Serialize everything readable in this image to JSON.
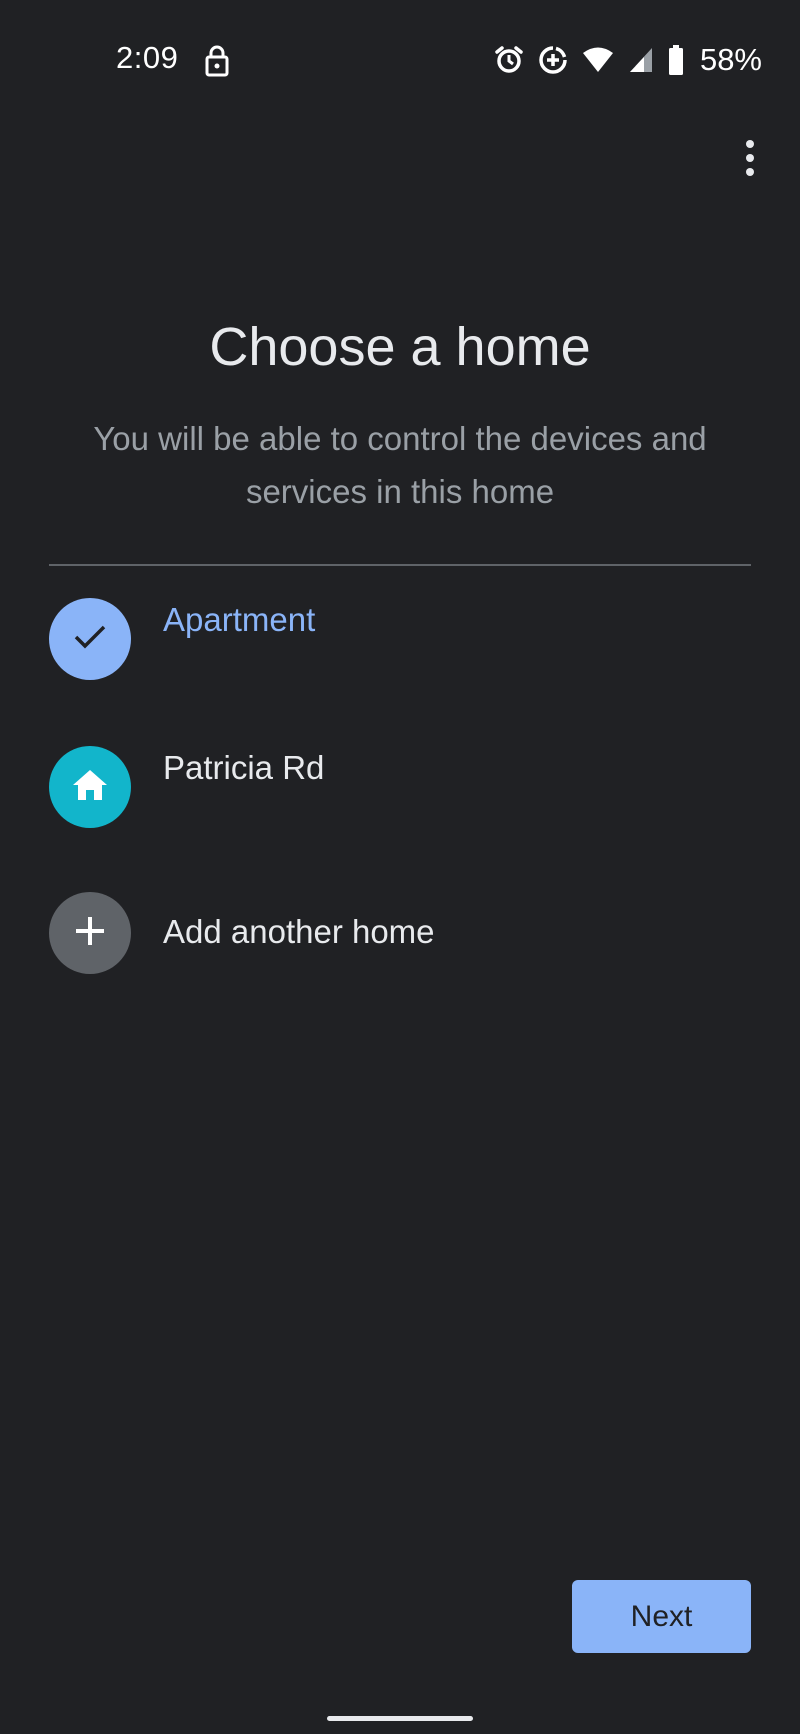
{
  "status_bar": {
    "time": "2:09",
    "battery": "58%",
    "icons": [
      "lock-icon",
      "alarm-icon",
      "data-saver-icon",
      "wifi-icon",
      "cell-signal-icon",
      "battery-icon"
    ]
  },
  "toolbar": {
    "menu_icon": "more-vert-icon"
  },
  "header": {
    "title": "Choose a home",
    "subtitle": "You will be able to control the devices and services in this home"
  },
  "homes": [
    {
      "label": "Apartment",
      "icon": "check-icon",
      "selected": true,
      "color": "#8ab4f8"
    },
    {
      "label": "Patricia Rd",
      "icon": "home-icon",
      "selected": false,
      "color": "#12b5cb"
    },
    {
      "label": "Add another home",
      "icon": "plus-icon",
      "selected": false,
      "color": "#5f6368"
    }
  ],
  "footer": {
    "next_label": "Next"
  },
  "colors": {
    "background": "#202124",
    "accent": "#8ab4f8",
    "text_primary": "#e8eaed",
    "text_secondary": "#9aa0a6"
  }
}
